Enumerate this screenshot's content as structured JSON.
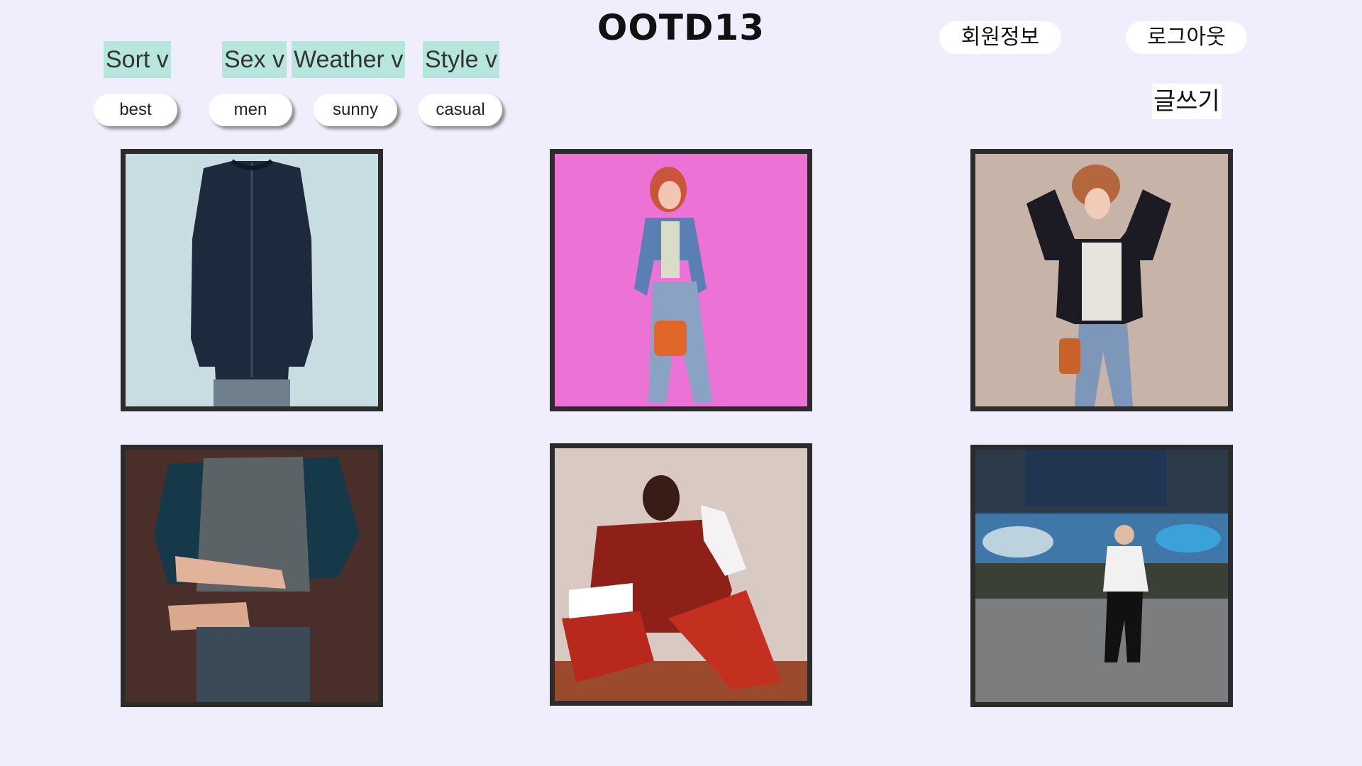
{
  "header": {
    "title": "OOTD13"
  },
  "filters": [
    {
      "label": "Sort v"
    },
    {
      "label": "Sex v"
    },
    {
      "label": "Weather v"
    },
    {
      "label": "Style v"
    }
  ],
  "chips": [
    {
      "label": "best"
    },
    {
      "label": "men"
    },
    {
      "label": "sunny"
    },
    {
      "label": "casual"
    }
  ],
  "account": {
    "member_info": "회원정보",
    "logout": "로그아웃",
    "write": "글쓰기"
  },
  "posts": [
    {
      "icon": "jacket-photo"
    },
    {
      "icon": "denim-woman-pink-photo"
    },
    {
      "icon": "leather-jacket-woman-photo"
    },
    {
      "icon": "vest-man-watch-photo"
    },
    {
      "icon": "red-outfit-photo"
    },
    {
      "icon": "street-man-photo"
    }
  ],
  "colors": {
    "background": "#f0eefc",
    "filter_bg": "#b7e6dd",
    "frame": "#2b2b2b"
  }
}
